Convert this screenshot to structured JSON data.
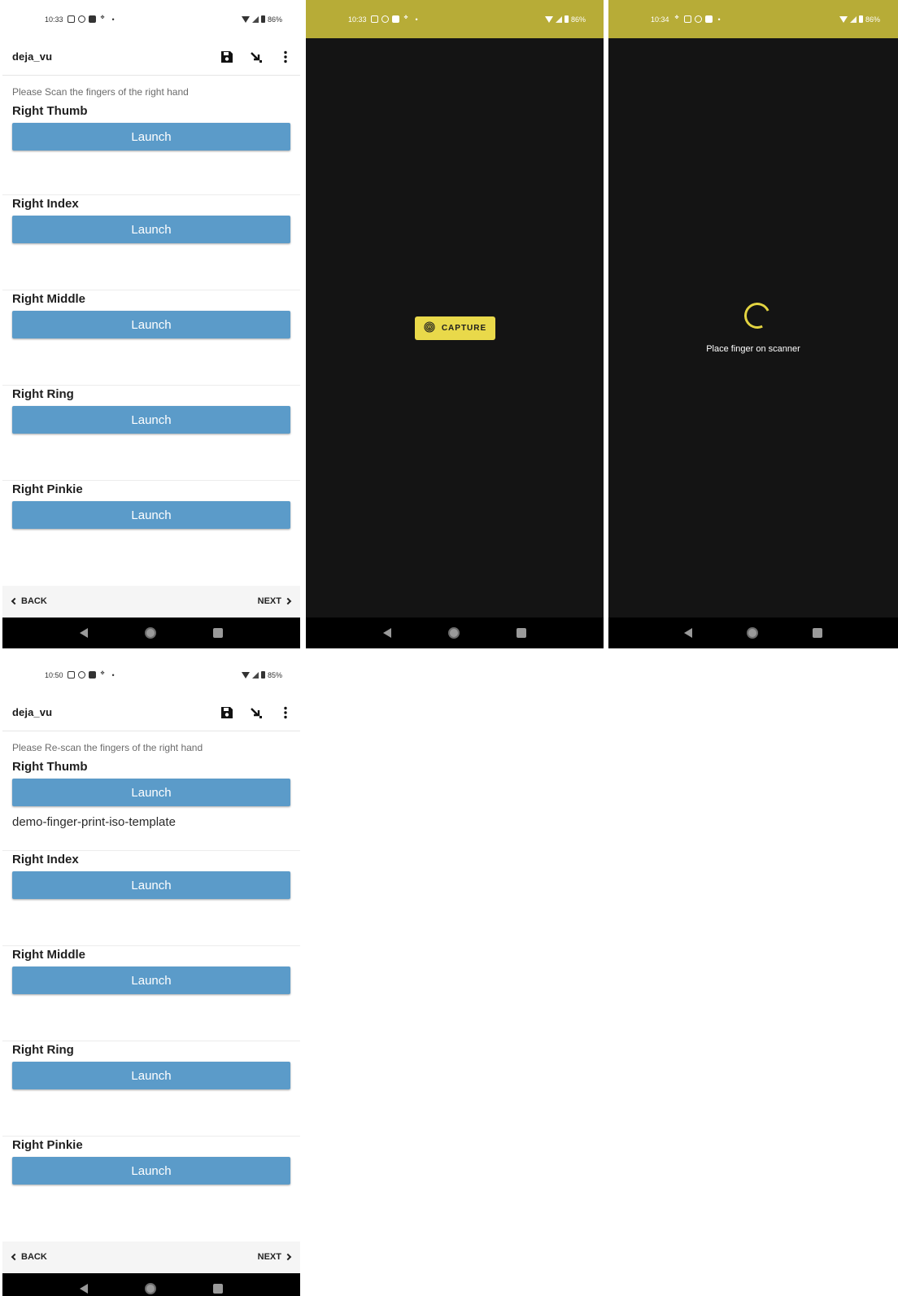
{
  "screen1": {
    "status": {
      "time": "10:33",
      "battery": "86%"
    },
    "app_title": "deja_vu",
    "prompt": "Please Scan the fingers of the right hand",
    "fingers": [
      {
        "label": "Right Thumb",
        "button": "Launch",
        "result": ""
      },
      {
        "label": "Right Index",
        "button": "Launch",
        "result": ""
      },
      {
        "label": "Right Middle",
        "button": "Launch",
        "result": ""
      },
      {
        "label": "Right Ring",
        "button": "Launch",
        "result": ""
      },
      {
        "label": "Right Pinkie",
        "button": "Launch",
        "result": ""
      }
    ],
    "back": "BACK",
    "next": "NEXT"
  },
  "screen2": {
    "status": {
      "time": "10:33",
      "battery": "86%"
    },
    "capture_label": "CAPTURE"
  },
  "screen3": {
    "status": {
      "time": "10:34",
      "battery": "86%"
    },
    "message": "Place finger on scanner"
  },
  "screen4": {
    "status": {
      "time": "10:50",
      "battery": "85%"
    },
    "app_title": "deja_vu",
    "prompt": "Please Re-scan the fingers of the right hand",
    "fingers": [
      {
        "label": "Right Thumb",
        "button": "Launch",
        "result": "demo-finger-print-iso-template"
      },
      {
        "label": "Right Index",
        "button": "Launch",
        "result": ""
      },
      {
        "label": "Right Middle",
        "button": "Launch",
        "result": ""
      },
      {
        "label": "Right Ring",
        "button": "Launch",
        "result": ""
      },
      {
        "label": "Right Pinkie",
        "button": "Launch",
        "result": ""
      }
    ],
    "back": "BACK",
    "next": "NEXT"
  },
  "colors": {
    "launch_button": "#5b9bc9",
    "status_bar_olive": "#b7ac37",
    "capture_button": "#e9d94a",
    "spinner": "#e3d441",
    "dark_background": "#141414"
  },
  "icons": {
    "appbar": [
      "save-icon",
      "arrow-down-right-icon",
      "more-vert-icon"
    ],
    "capture": "fingerprint-icon",
    "nav": [
      "nav-back-icon",
      "nav-home-icon",
      "nav-recents-icon"
    ]
  }
}
